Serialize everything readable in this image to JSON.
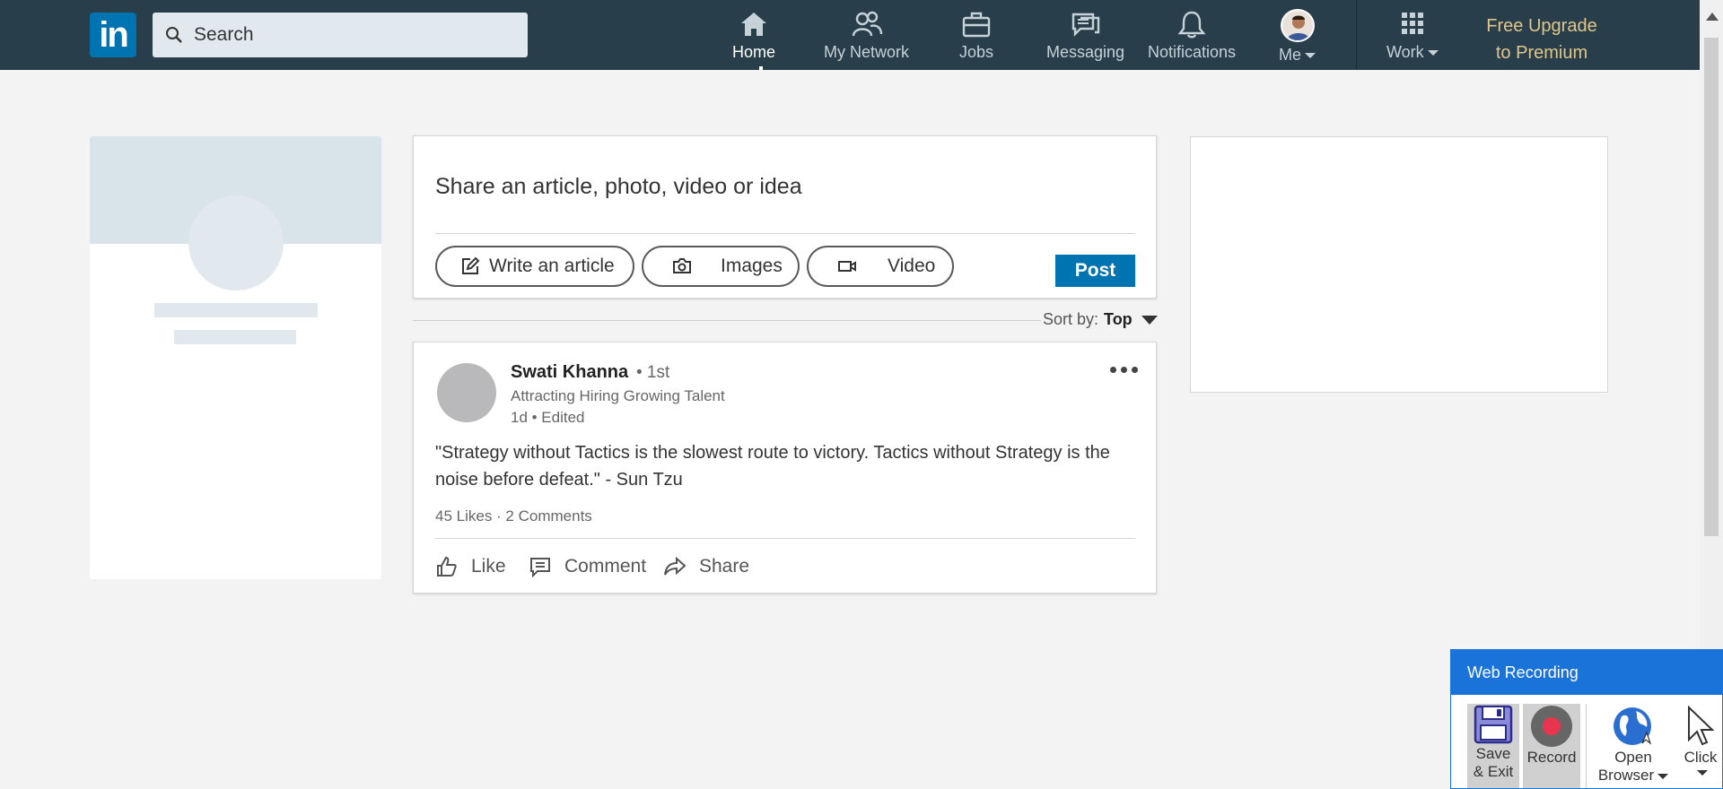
{
  "nav": {
    "logo_text": "in",
    "search_placeholder": "Search",
    "items": [
      {
        "label": "Home",
        "icon": "home-icon"
      },
      {
        "label": "My Network",
        "icon": "network-icon"
      },
      {
        "label": "Jobs",
        "icon": "briefcase-icon"
      },
      {
        "label": "Messaging",
        "icon": "messaging-icon"
      },
      {
        "label": "Notifications",
        "icon": "bell-icon"
      },
      {
        "label": "Me",
        "icon": "avatar"
      },
      {
        "label": "Work",
        "icon": "grid-icon"
      }
    ],
    "premium_line1": "Free Upgrade",
    "premium_line2": "to Premium"
  },
  "share": {
    "prompt": "Share an article, photo, video or idea",
    "write_article": "Write an article",
    "images": "Images",
    "video": "Video",
    "post": "Post"
  },
  "sort": {
    "label": "Sort by:",
    "value": "Top"
  },
  "post": {
    "author": "Swati Khanna",
    "degree": "• 1st",
    "headline": "Attracting Hiring Growing Talent",
    "time": "1d • Edited",
    "body": "\"Strategy without Tactics is the slowest route to victory.  Tactics without Strategy is the noise before defeat.\" - Sun Tzu",
    "counts": "45 Likes · 2 Comments",
    "actions": {
      "like": "Like",
      "comment": "Comment",
      "share": "Share"
    }
  },
  "web_recording": {
    "title": "Web Recording",
    "save_exit_line1": "Save",
    "save_exit_line2": "& Exit",
    "record": "Record",
    "open_line1": "Open",
    "open_line2": "Browser",
    "click": "Click"
  },
  "colors": {
    "nav_bg": "#283e4a",
    "brand_blue": "#0073b1",
    "premium_gold": "#e0c68b",
    "recording_blue": "#1a73d8"
  }
}
